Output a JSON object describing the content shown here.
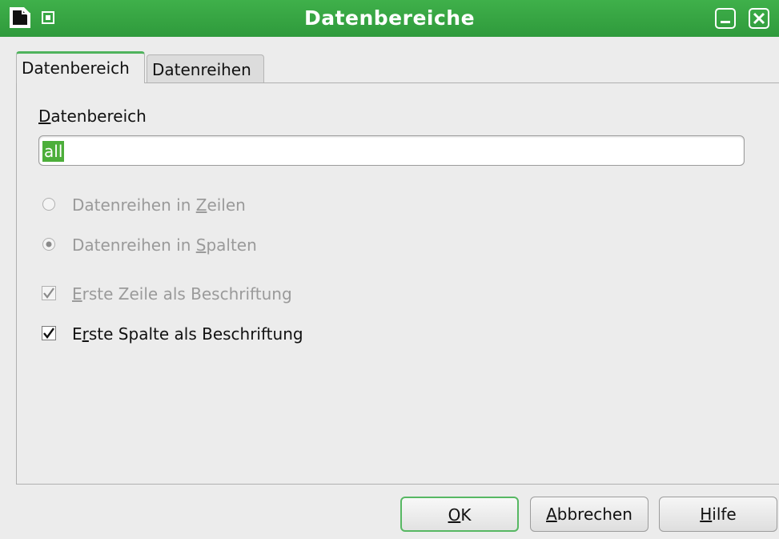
{
  "window": {
    "title": "Datenbereiche",
    "accent_color": "#3aa846",
    "icons": [
      "document-icon",
      "window-menu-icon",
      "minimize-icon",
      "close-icon"
    ]
  },
  "tabs": [
    {
      "label": "Datenbereich",
      "active": true
    },
    {
      "label": "Datenreihen",
      "active": false
    }
  ],
  "range": {
    "label": "Datenbereich",
    "label_mnemonic": "D",
    "value": "all"
  },
  "options": {
    "rows": {
      "label_before": "Datenreihen in ",
      "mnemonic": "Z",
      "label_after": "eilen",
      "checked": false,
      "enabled": false
    },
    "cols": {
      "label_before": "Datenreihen in ",
      "mnemonic": "S",
      "label_after": "palten",
      "checked": true,
      "enabled": false
    },
    "first_row": {
      "label_before": "",
      "mnemonic": "E",
      "label_after": "rste Zeile als Beschriftung",
      "checked": true,
      "enabled": false
    },
    "first_col": {
      "label_before": "E",
      "mnemonic": "r",
      "label_after": "ste Spalte als Beschriftung",
      "checked": true,
      "enabled": true
    }
  },
  "buttons": {
    "ok": {
      "mnemonic": "O",
      "rest": "K"
    },
    "cancel": {
      "mnemonic": "A",
      "rest": "bbrechen"
    },
    "help": {
      "mnemonic": "H",
      "rest": "ilfe"
    }
  }
}
